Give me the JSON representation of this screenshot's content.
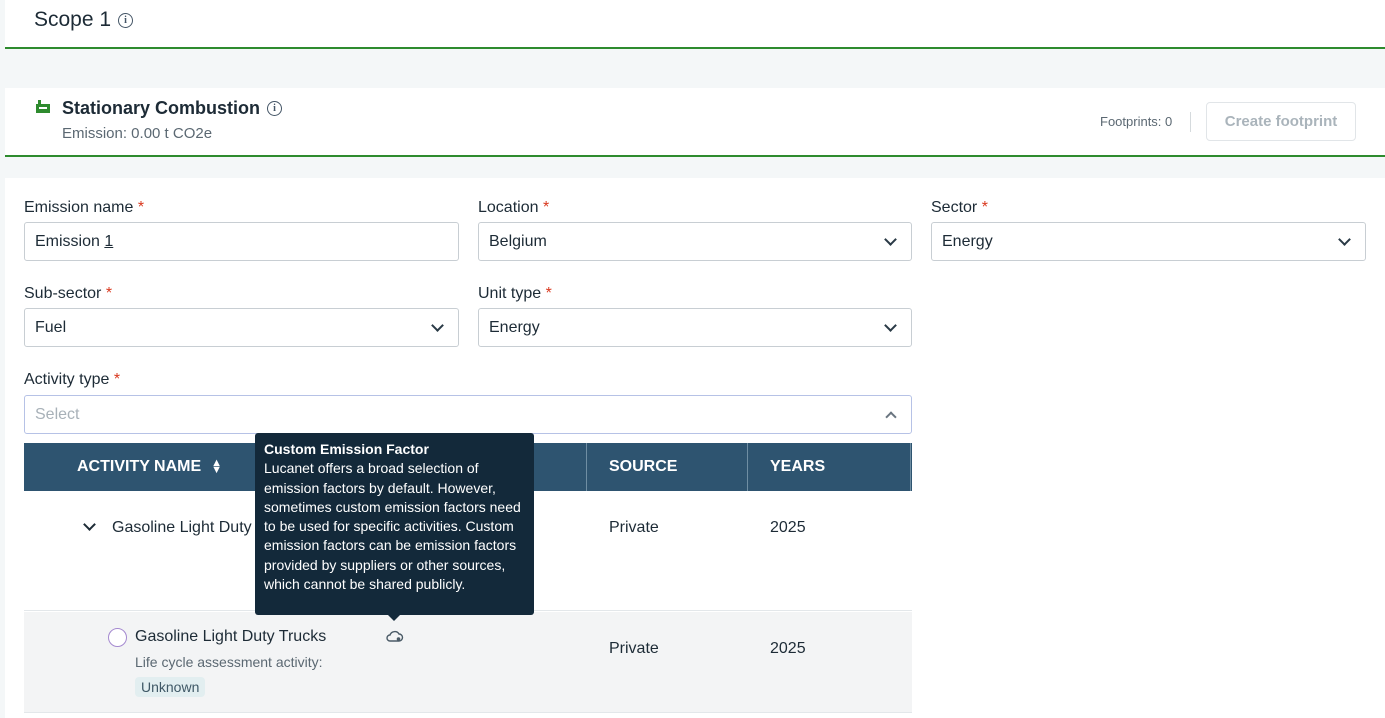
{
  "scope": {
    "title": "Scope 1",
    "info_icon": "info-icon"
  },
  "section": {
    "title": "Stationary Combustion",
    "emission": "Emission: 0.00 t CO2e",
    "footprints": "Footprints: 0",
    "create_button": "Create footprint",
    "icon": "factory-icon",
    "accent_color": "#2e8b2e"
  },
  "form": {
    "emission_name": {
      "label": "Emission name",
      "value_prefix": "Emission ",
      "value_suffix": "1"
    },
    "location": {
      "label": "Location",
      "value": "Belgium"
    },
    "sector": {
      "label": "Sector",
      "value": "Energy"
    },
    "sub_sector": {
      "label": "Sub-sector",
      "value": "Fuel"
    },
    "unit_type": {
      "label": "Unit type",
      "value": "Energy"
    },
    "activity_type": {
      "label": "Activity type",
      "placeholder": "Select"
    },
    "required_mark": "*"
  },
  "table": {
    "columns": {
      "activity_name": "ACTIVITY NAME",
      "source": "SOURCE",
      "years": "YEARS"
    },
    "header_color": "#2e5470",
    "rows": [
      {
        "name": "Gasoline Light Duty",
        "source": "Private",
        "years": "2025"
      },
      {
        "name": "Gasoline Light Duty Trucks",
        "lca_label": "Life cycle assessment activity:",
        "lca_value": "Unknown",
        "source": "Private",
        "years": "2025"
      }
    ]
  },
  "tooltip": {
    "title": "Custom Emission Factor",
    "body": "Lucanet offers a broad selection of emission factors by default. However, sometimes custom emission factors need to be used for specific activities. Custom emission factors can be emission factors provided by suppliers or other sources, which cannot be shared publicly."
  }
}
